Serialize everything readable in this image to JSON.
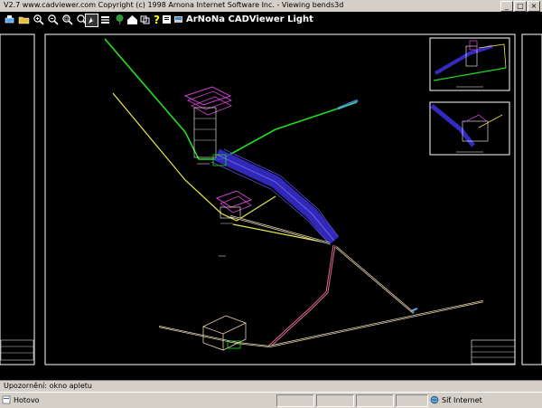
{
  "window": {
    "title": "V2.7 www.cadviewer.com Copyright (c) 1998 Arnona Internet Software Inc. - Viewing bends3d",
    "buttons": [
      "_",
      "□",
      "×"
    ]
  },
  "toolbar": {
    "brand": "ArNoNa CADViewer Light",
    "tools": [
      "print-icon",
      "open-icon",
      "zoom-in-icon",
      "zoom-out-icon",
      "zoom-window-icon",
      "zoom-extents-icon",
      "pan-icon",
      "layers-icon",
      "tree-icon",
      "home-icon",
      "views-icon",
      "help-icon",
      "info-icon",
      "settings-icon"
    ]
  },
  "applet_status": "Upozornění: okno apletu",
  "statusbar": {
    "left": "Hotovo",
    "zone": "Síť Internet"
  },
  "colors": {
    "canvas": "#000000",
    "green": "#22dd22",
    "yellow": "#e8e84a",
    "blue": "#3a2fd8",
    "magenta": "#d040d0",
    "pink": "#e06c8c",
    "white": "#ffffff"
  }
}
